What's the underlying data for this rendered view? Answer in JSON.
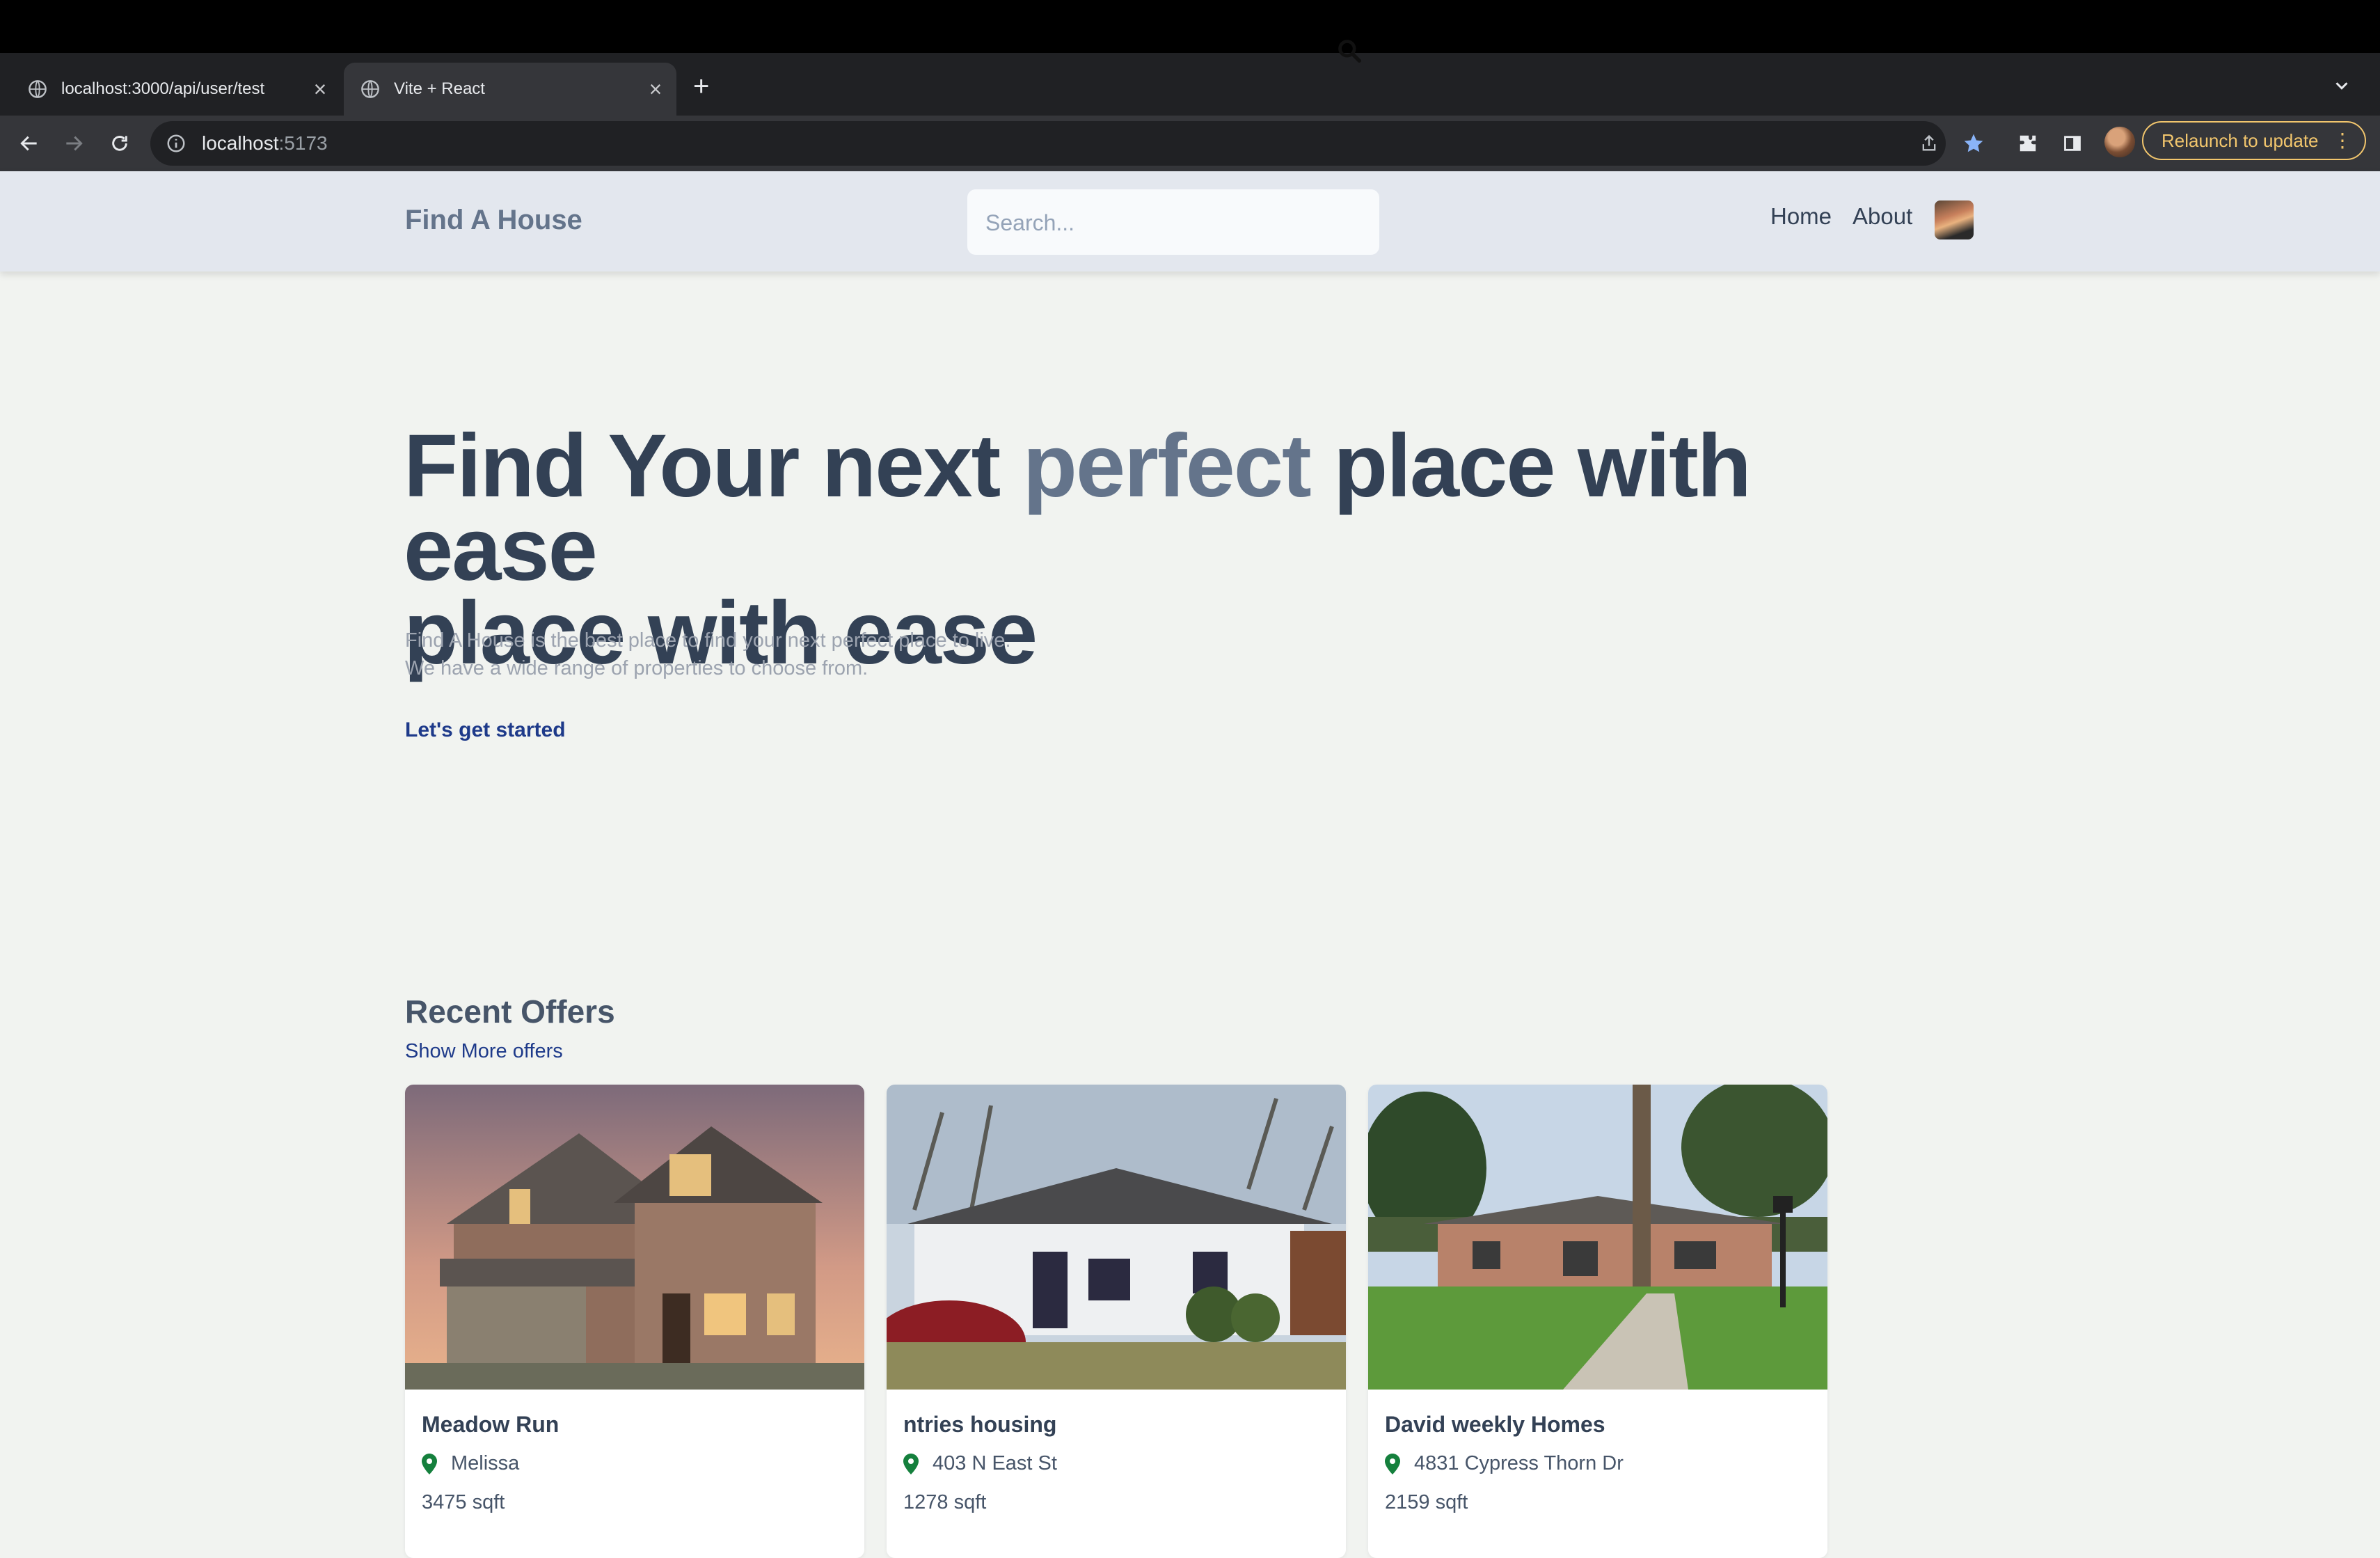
{
  "browser": {
    "tabs": [
      {
        "title": "localhost:3000/api/user/test",
        "active": false
      },
      {
        "title": "Vite + React",
        "active": true
      }
    ],
    "url_host": "localhost",
    "url_port": ":5173",
    "relaunch_label": "Relaunch to update"
  },
  "header": {
    "brand": "Find A House",
    "search_placeholder": "Search...",
    "nav": [
      "Home",
      "About"
    ]
  },
  "hero": {
    "title_part1": "Find Your next ",
    "title_accent": "perfect",
    "title_part2": " place with ease",
    "title_line2": "place with ease",
    "desc_line1": "Find A House is the best place to find your next perfect place to live.",
    "desc_line2": "We have a wide range of properties to choose from.",
    "cta": "Let's get started"
  },
  "offers": {
    "title": "Recent Offers",
    "show_more": "Show More offers",
    "cards": [
      {
        "name": "Meadow Run",
        "location": "Melissa",
        "sqft": "3475 sqft"
      },
      {
        "name": "ntries housing",
        "location": "403 N East St",
        "sqft": "1278 sqft"
      },
      {
        "name": "David weekly Homes",
        "location": "4831 Cypress Thorn Dr",
        "sqft": "2159 sqft"
      }
    ]
  },
  "colors": {
    "accent": "#64748b",
    "heading": "#334155",
    "link": "#1e3a8a",
    "pin": "#15803d"
  }
}
